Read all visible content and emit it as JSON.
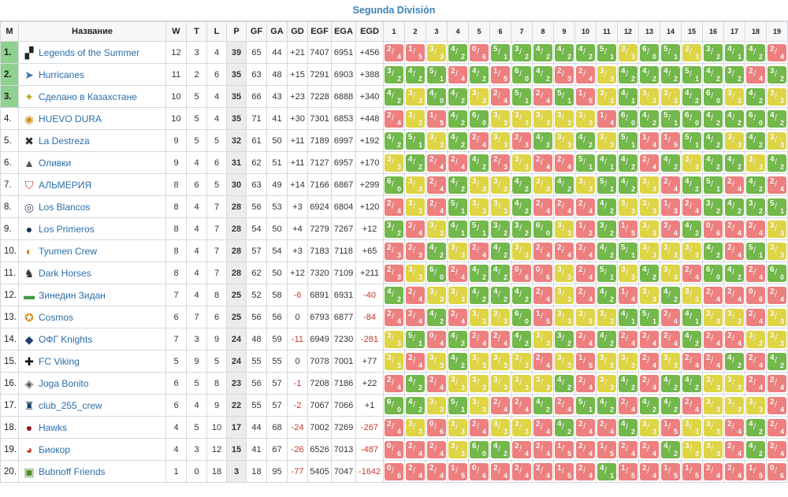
{
  "title": "Segunda División",
  "colors": {
    "win": "#72b84a",
    "draw": "#dfd544",
    "loss": "#ee7f7f",
    "top": "#8fd28f",
    "link": "#2a6ea8"
  },
  "headers": [
    "M",
    "Название",
    "W",
    "T",
    "L",
    "P",
    "GF",
    "GA",
    "GD",
    "EGF",
    "EGA",
    "EGD"
  ],
  "match_headers": [
    "1",
    "2",
    "3",
    "4",
    "5",
    "6",
    "7",
    "8",
    "9",
    "10",
    "11",
    "12",
    "13",
    "14",
    "15",
    "16",
    "17",
    "18",
    "19"
  ],
  "rows": [
    {
      "pos": "1.",
      "name": "Legends of the Summer",
      "icon": "legends-logo-icon",
      "w": "12",
      "t": "3",
      "l": "4",
      "p": "39",
      "gf": "65",
      "ga": "44",
      "gd": "+21",
      "egf": "7407",
      "ega": "6951",
      "egd": "+456",
      "m": [
        "2/4",
        "1/5",
        "3/3",
        "4/2",
        "0/6",
        "5/1",
        "3/2",
        "4/2",
        "4/2",
        "4/2",
        "5/1",
        "3/3",
        "6/0",
        "5/1",
        "3/3",
        "3/2",
        "4/1",
        "4/2",
        "2/4"
      ]
    },
    {
      "pos": "2.",
      "name": "Hurricanes",
      "icon": "hurricanes-logo-icon",
      "w": "11",
      "t": "2",
      "l": "6",
      "p": "35",
      "gf": "63",
      "ga": "48",
      "gd": "+15",
      "egf": "7291",
      "ega": "6903",
      "egd": "+388",
      "m": [
        "3/2",
        "4/2",
        "5/1",
        "2/4",
        "4/2",
        "1/5",
        "6/0",
        "4/2",
        "2/3",
        "2/4",
        "3/3",
        "4/2",
        "4/2",
        "4/2",
        "5/1",
        "4/2",
        "3/2",
        "2/4",
        "3/2"
      ]
    },
    {
      "pos": "3.",
      "name": "Сделано в Казахстане",
      "icon": "kazakhstan-logo-icon",
      "w": "10",
      "t": "5",
      "l": "4",
      "p": "35",
      "gf": "66",
      "ga": "43",
      "gd": "+23",
      "egf": "7228",
      "ega": "6888",
      "egd": "+340",
      "m": [
        "4/2",
        "3/3",
        "4/0",
        "4/2",
        "3/3",
        "2/4",
        "5/1",
        "2/4",
        "5/1",
        "1/5",
        "3/3",
        "4/1",
        "3/3",
        "3/3",
        "4/2",
        "6/0",
        "3/3",
        "4/2",
        "3/3"
      ]
    },
    {
      "pos": "4.",
      "name": "HUEVO DURA",
      "icon": "huevo-logo-icon",
      "w": "10",
      "t": "5",
      "l": "4",
      "p": "35",
      "gf": "71",
      "ga": "41",
      "gd": "+30",
      "egf": "7301",
      "ega": "6853",
      "egd": "+448",
      "m": [
        "2/4",
        "3/3",
        "1/5",
        "4/2",
        "6/0",
        "3/3",
        "3/3",
        "3/3",
        "3/3",
        "3/3",
        "1/4",
        "6/0",
        "4/2",
        "5/1",
        "6/0",
        "4/2",
        "4/2",
        "6/0",
        "4/2"
      ]
    },
    {
      "pos": "5.",
      "name": "La Destreza",
      "icon": "destreza-logo-icon",
      "w": "9",
      "t": "5",
      "l": "5",
      "p": "32",
      "gf": "61",
      "ga": "50",
      "gd": "+11",
      "egf": "7189",
      "ega": "6997",
      "egd": "+192",
      "m": [
        "4/2",
        "5/1",
        "3/3",
        "4/2",
        "2/4",
        "3/3",
        "2/3",
        "4/2",
        "3/3",
        "4/2",
        "3/3",
        "5/1",
        "1/4",
        "1/5",
        "5/1",
        "4/2",
        "3/3",
        "4/2",
        "3/3"
      ]
    },
    {
      "pos": "6.",
      "name": "Оливки",
      "icon": "olivki-logo-icon",
      "w": "9",
      "t": "4",
      "l": "6",
      "p": "31",
      "gf": "62",
      "ga": "51",
      "gd": "+11",
      "egf": "7127",
      "ega": "6957",
      "egd": "+170",
      "m": [
        "3/3",
        "4/2",
        "2/4",
        "2/4",
        "4/2",
        "2/3",
        "3/3",
        "2/4",
        "2/4",
        "5/1",
        "4/1",
        "4/2",
        "2/4",
        "4/2",
        "3/3",
        "4/2",
        "4/2",
        "3/3",
        "4/2"
      ]
    },
    {
      "pos": "7.",
      "name": "АЛЬМЕРИЯ",
      "icon": "almeria-logo-icon",
      "w": "8",
      "t": "6",
      "l": "5",
      "p": "30",
      "gf": "63",
      "ga": "49",
      "gd": "+14",
      "egf": "7166",
      "ega": "6867",
      "egd": "+299",
      "m": [
        "6/0",
        "3/3",
        "2/4",
        "4/2",
        "3/3",
        "3/3",
        "4/2",
        "3/3",
        "4/2",
        "3/3",
        "5/1",
        "4/2",
        "3/3",
        "2/4",
        "4/2",
        "5/1",
        "2/4",
        "4/2",
        "2/4"
      ]
    },
    {
      "pos": "8.",
      "name": "Los Blancos",
      "icon": "blancos-logo-icon",
      "w": "8",
      "t": "4",
      "l": "7",
      "p": "28",
      "gf": "56",
      "ga": "53",
      "gd": "+3",
      "egf": "6924",
      "ega": "6804",
      "egd": "+120",
      "m": [
        "2/4",
        "3/3",
        "2/4",
        "5/1",
        "3/3",
        "3/3",
        "4/2",
        "2/4",
        "2/4",
        "2/4",
        "4/2",
        "3/3",
        "3/3",
        "1/3",
        "2/4",
        "3/2",
        "4/2",
        "3/2",
        "5/1"
      ]
    },
    {
      "pos": "9.",
      "name": "Los Primeros",
      "icon": "primeros-logo-icon",
      "w": "8",
      "t": "4",
      "l": "7",
      "p": "28",
      "gf": "54",
      "ga": "50",
      "gd": "+4",
      "egf": "7279",
      "ega": "7267",
      "egd": "+12",
      "m": [
        "3/2",
        "2/4",
        "3/3",
        "4/1",
        "5/1",
        "3/2",
        "3/2",
        "6/0",
        "3/3",
        "1/2",
        "3/2",
        "1/5",
        "3/3",
        "2/4",
        "4/2",
        "0/6",
        "2/4",
        "2/4",
        "3/3"
      ]
    },
    {
      "pos": "10.",
      "name": "Tyumen Crew",
      "icon": "tyumen-logo-icon",
      "w": "8",
      "t": "4",
      "l": "7",
      "p": "28",
      "gf": "57",
      "ga": "54",
      "gd": "+3",
      "egf": "7183",
      "ega": "7118",
      "egd": "+65",
      "m": [
        "2/3",
        "2/3",
        "4/2",
        "3/3",
        "2/4",
        "4/2",
        "3/3",
        "2/4",
        "2/4",
        "2/4",
        "4/2",
        "5/1",
        "3/3",
        "3/3",
        "3/3",
        "4/2",
        "2/4",
        "5/1",
        "3/3"
      ]
    },
    {
      "pos": "11.",
      "name": "Dark Horses",
      "icon": "darkhorses-logo-icon",
      "w": "8",
      "t": "4",
      "l": "7",
      "p": "28",
      "gf": "62",
      "ga": "50",
      "gd": "+12",
      "egf": "7320",
      "ega": "7109",
      "egd": "+211",
      "m": [
        "2/3",
        "3/3",
        "6/0",
        "2/4",
        "4/2",
        "4/2",
        "0/6",
        "0/6",
        "3/3",
        "2/4",
        "5/1",
        "3/3",
        "4/2",
        "3/3",
        "2/4",
        "6/0",
        "4/2",
        "2/4",
        "6/0"
      ]
    },
    {
      "pos": "12.",
      "name": "Зинедин Зидан",
      "icon": "zidane-logo-icon",
      "w": "7",
      "t": "4",
      "l": "8",
      "p": "25",
      "gf": "52",
      "ga": "58",
      "gd": "-6",
      "egf": "6891",
      "ega": "6931",
      "egd": "-40",
      "m": [
        "4/2",
        "2/4",
        "3/3",
        "3/3",
        "4/2",
        "4/2",
        "4/2",
        "2/4",
        "3/3",
        "2/4",
        "4/2",
        "1/4",
        "3/3",
        "4/2",
        "3/3",
        "2/4",
        "2/4",
        "0/6",
        "2/4"
      ]
    },
    {
      "pos": "13.",
      "name": "Cosmos",
      "icon": "cosmos-logo-icon",
      "w": "6",
      "t": "7",
      "l": "6",
      "p": "25",
      "gf": "56",
      "ga": "56",
      "gd": "0",
      "egf": "6793",
      "ega": "6877",
      "egd": "-84",
      "m": [
        "2/4",
        "2/4",
        "4/2",
        "2/4",
        "3/3",
        "3/3",
        "6/0",
        "1/5",
        "3/3",
        "3/3",
        "3/3",
        "4/1",
        "5/1",
        "2/4",
        "4/1",
        "3/3",
        "3/3",
        "2/4",
        "3/3"
      ]
    },
    {
      "pos": "14.",
      "name": "ОФГ Knights",
      "icon": "knights-logo-icon",
      "w": "7",
      "t": "3",
      "l": "9",
      "p": "24",
      "gf": "48",
      "ga": "59",
      "gd": "-11",
      "egf": "6949",
      "ega": "7230",
      "egd": "-281",
      "m": [
        "3/3",
        "5/1",
        "0/4",
        "4/2",
        "2/4",
        "2/4",
        "4/2",
        "3/3",
        "3/2",
        "2/4",
        "4/2",
        "2/4",
        "2/4",
        "2/4",
        "4/2",
        "2/4",
        "2/4",
        "3/3",
        "3/3"
      ]
    },
    {
      "pos": "15.",
      "name": "FC Viking",
      "icon": "viking-logo-icon",
      "w": "5",
      "t": "9",
      "l": "5",
      "p": "24",
      "gf": "55",
      "ga": "55",
      "gd": "0",
      "egf": "7078",
      "ega": "7001",
      "egd": "+77",
      "m": [
        "3/3",
        "2/4",
        "3/3",
        "4/2",
        "3/3",
        "3/3",
        "3/3",
        "2/4",
        "3/3",
        "1/5",
        "3/3",
        "3/3",
        "2/4",
        "3/3",
        "2/4",
        "2/4",
        "4/2",
        "2/4",
        "4/2"
      ]
    },
    {
      "pos": "16.",
      "name": "Joga Bonito",
      "icon": "joga-logo-icon",
      "w": "6",
      "t": "5",
      "l": "8",
      "p": "23",
      "gf": "56",
      "ga": "57",
      "gd": "-1",
      "egf": "7208",
      "ega": "7186",
      "egd": "+22",
      "m": [
        "2/4",
        "4/2",
        "2/4",
        "3/3",
        "3/3",
        "3/3",
        "3/3",
        "3/3",
        "4/2",
        "2/4",
        "3/3",
        "4/2",
        "2/4",
        "4/2",
        "4/2",
        "3/3",
        "3/3",
        "2/4",
        "2/4"
      ]
    },
    {
      "pos": "17.",
      "name": "club_255_crew",
      "icon": "club255-logo-icon",
      "w": "6",
      "t": "4",
      "l": "9",
      "p": "22",
      "gf": "55",
      "ga": "57",
      "gd": "-2",
      "egf": "7067",
      "ega": "7066",
      "egd": "+1",
      "m": [
        "6/0",
        "4/2",
        "3/3",
        "5/1",
        "3/3",
        "2/4",
        "2/4",
        "4/2",
        "2/4",
        "5/1",
        "4/2",
        "2/4",
        "4/2",
        "4/2",
        "2/4",
        "3/3",
        "3/3",
        "3/3",
        "2/4"
      ]
    },
    {
      "pos": "18.",
      "name": "Hawks",
      "icon": "hawks-logo-icon",
      "w": "4",
      "t": "5",
      "l": "10",
      "p": "17",
      "gf": "44",
      "ga": "68",
      "gd": "-24",
      "egf": "7002",
      "ega": "7269",
      "egd": "-267",
      "m": [
        "2/4",
        "3/3",
        "0/6",
        "3/3",
        "2/4",
        "3/3",
        "3/3",
        "2/4",
        "4/2",
        "2/4",
        "2/4",
        "4/2",
        "3/3",
        "1/5",
        "3/3",
        "3/3",
        "2/4",
        "4/2",
        "2/4"
      ]
    },
    {
      "pos": "19.",
      "name": "Биокор",
      "icon": "biokor-logo-icon",
      "w": "4",
      "t": "3",
      "l": "12",
      "p": "15",
      "gf": "41",
      "ga": "67",
      "gd": "-26",
      "egf": "6526",
      "ega": "7013",
      "egd": "-487",
      "m": [
        "0/6",
        "2/4",
        "2/4",
        "3/3",
        "6/0",
        "4/2",
        "2/4",
        "2/4",
        "1/5",
        "2/4",
        "1/5",
        "2/4",
        "2/4",
        "4/2",
        "3/3",
        "3/3",
        "2/4",
        "4/2",
        "2/4"
      ]
    },
    {
      "pos": "20.",
      "name": "Bubnoff Friends",
      "icon": "bubnoff-logo-icon",
      "w": "1",
      "t": "0",
      "l": "18",
      "p": "3",
      "gf": "18",
      "ga": "95",
      "gd": "-77",
      "egf": "5405",
      "ega": "7047",
      "egd": "-1642",
      "m": [
        "0/6",
        "2/4",
        "2/4",
        "1/5",
        "0/6",
        "2/4",
        "2/4",
        "2/4",
        "1/5",
        "2/4",
        "4/1",
        "1/5",
        "2/4",
        "1/5",
        "1/5",
        "2/4",
        "2/4",
        "1/5",
        "0/6"
      ]
    }
  ]
}
